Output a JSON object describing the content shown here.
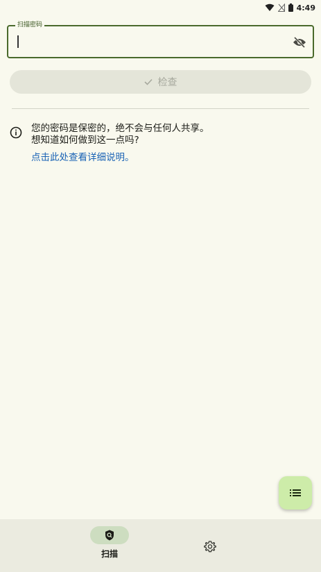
{
  "status_bar": {
    "time": "4:49"
  },
  "password_field": {
    "label": "扫描密码",
    "value": "",
    "placeholder": ""
  },
  "check_button": {
    "label": "检查"
  },
  "info": {
    "line1": "您的密码是保密的，绝不会与任何人共享。",
    "line2": "想知道如何做到这一点吗?",
    "link": "点击此处查看详细说明。"
  },
  "bottom_nav": {
    "items": [
      {
        "label": "扫描",
        "icon": "shield-search-icon",
        "selected": true
      },
      {
        "label": "",
        "icon": "gear-icon",
        "selected": false
      }
    ]
  },
  "fab": {
    "icon": "list-icon"
  },
  "colors": {
    "background": "#f9f9ee",
    "field_border": "#4a6a2c",
    "link": "#1a63b5",
    "fab": "#cdeca9",
    "nav_pill": "#cdddc0",
    "nav_bar": "#ebebe0"
  }
}
